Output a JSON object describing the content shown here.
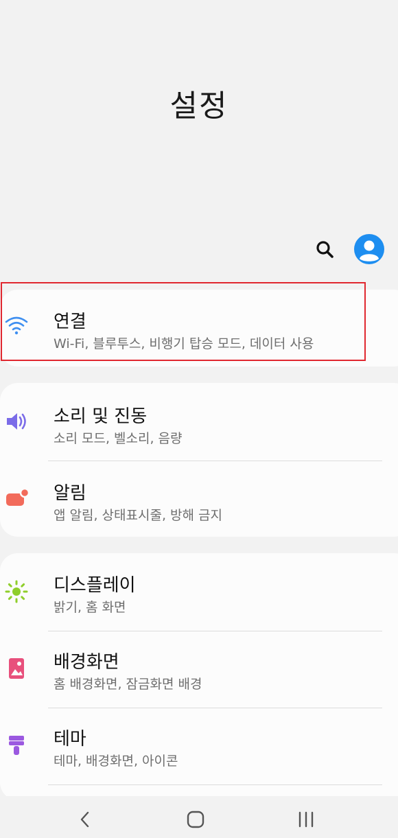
{
  "header": {
    "title": "설정",
    "search_icon": "search-icon",
    "profile_icon": "profile-icon"
  },
  "settings": [
    {
      "id": "connections",
      "title": "연결",
      "subtitle": "Wi-Fi, 블루투스, 비행기 탑승 모드, 데이터 사용",
      "icon": "wifi-icon",
      "icon_color": "#3f8ff0"
    },
    {
      "id": "sounds",
      "title": "소리 및 진동",
      "subtitle": "소리 모드, 벨소리, 음량",
      "icon": "speaker-icon",
      "icon_color": "#7b6ce8"
    },
    {
      "id": "notifications",
      "title": "알림",
      "subtitle": "앱 알림, 상태표시줄, 방해 금지",
      "icon": "notification-icon",
      "icon_color": "#f26b5b"
    },
    {
      "id": "display",
      "title": "디스플레이",
      "subtitle": "밝기, 홈 화면",
      "icon": "brightness-icon",
      "icon_color": "#8fce2b"
    },
    {
      "id": "wallpapers",
      "title": "배경화면",
      "subtitle": "홈 배경화면, 잠금화면 배경",
      "icon": "wallpaper-icon",
      "icon_color": "#e8507c"
    },
    {
      "id": "themes",
      "title": "테마",
      "subtitle": "테마, 배경화면, 아이콘",
      "icon": "theme-brush-icon",
      "icon_color": "#9b59e0"
    }
  ],
  "navigation": {
    "back_icon": "back-icon",
    "home_icon": "home-icon",
    "recents_icon": "recents-icon"
  },
  "colors": {
    "background": "#f2f2f2",
    "card": "#fcfcfc",
    "accent": "#1e8ef0",
    "highlight": "#e0272f"
  }
}
